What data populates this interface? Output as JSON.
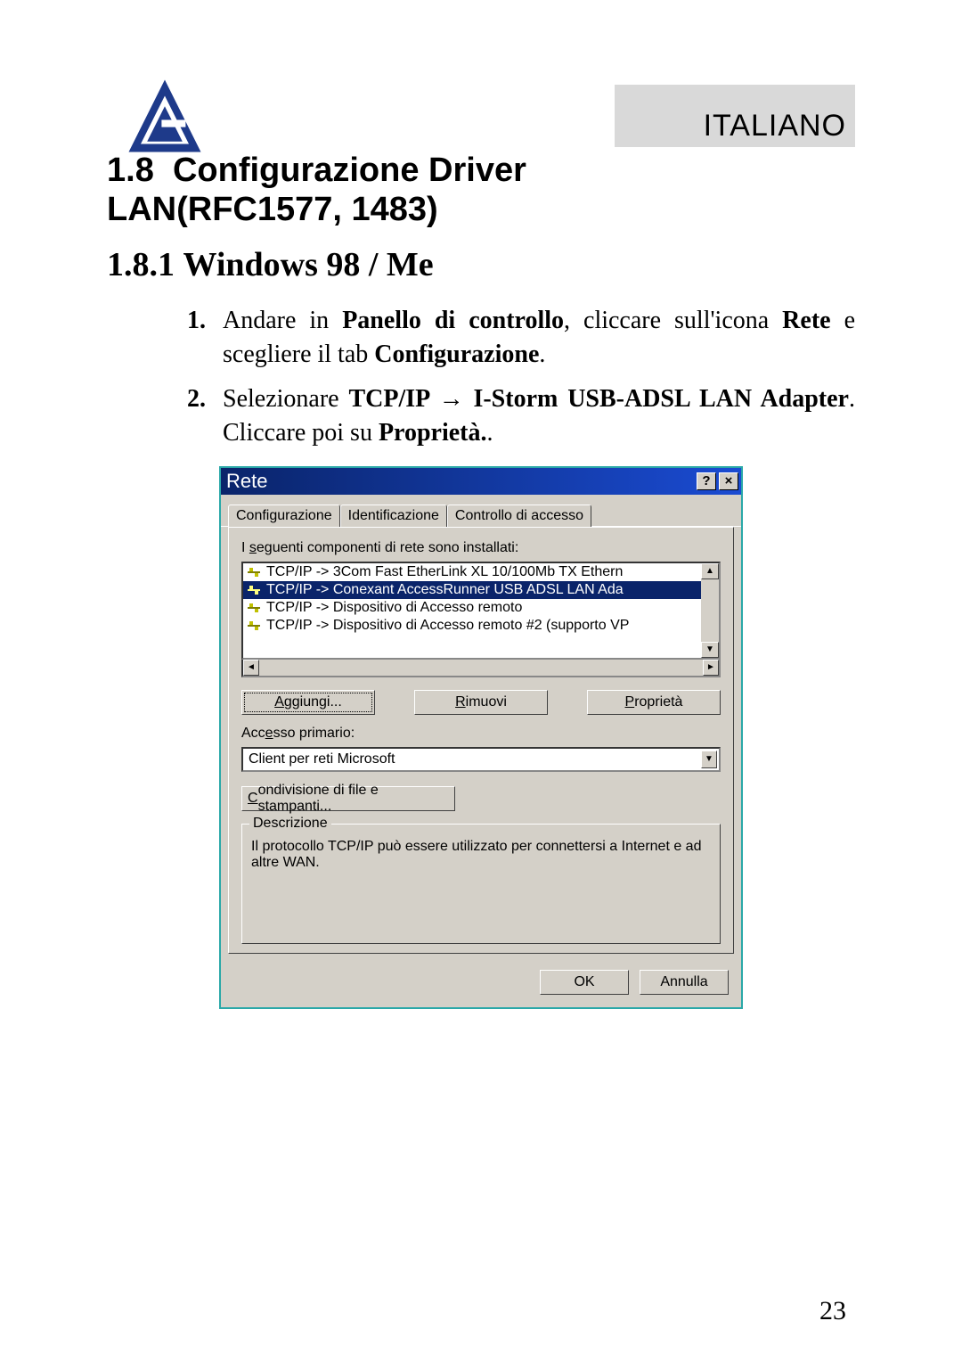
{
  "header": {
    "language": "ITALIANO"
  },
  "section": {
    "num": "1.8",
    "title_line1": "Configurazione Driver",
    "title_line2": "LAN(RFC1577, 1483)",
    "sub_num": "1.8.1",
    "sub_title": "Windows 98 / Me"
  },
  "steps": [
    {
      "n": "1.",
      "pre": "Andare in ",
      "b1": "Panello di controllo",
      "mid1": ", cliccare sull'icona ",
      "b2": "Rete",
      "mid2": " e scegliere il tab ",
      "b3": "Configurazione",
      "post": "."
    },
    {
      "n": "2.",
      "pre": "Selezionare  ",
      "b1": "TCP/IP → I-Storm USB-ADSL LAN Adapter",
      "mid1": ". Cliccare poi su ",
      "b2": "Proprietà.",
      "post": "."
    }
  ],
  "dialog": {
    "title": "Rete",
    "tabs": [
      "Configurazione",
      "Identificazione",
      "Controllo di accesso"
    ],
    "list_label": "I seguenti componenti di rete sono installati:",
    "items": [
      "TCP/IP -> 3Com Fast EtherLink XL 10/100Mb TX Ethern",
      "TCP/IP -> Conexant AccessRunner USB ADSL LAN Ada",
      "TCP/IP -> Dispositivo di Accesso remoto",
      "TCP/IP -> Dispositivo di Accesso remoto #2 (supporto VP"
    ],
    "selected_index": 1,
    "buttons": {
      "add": "Aggiungi...",
      "remove": "Rimuovi",
      "props": "Proprietà"
    },
    "primary_label": "Accesso primario:",
    "primary_value": "Client per reti Microsoft",
    "share_btn": "Condivisione di file e stampanti...",
    "group_title": "Descrizione",
    "description": "Il protocollo TCP/IP può essere utilizzato per connettersi a Internet e ad altre WAN.",
    "ok": "OK",
    "cancel": "Annulla"
  },
  "page_number": "23"
}
